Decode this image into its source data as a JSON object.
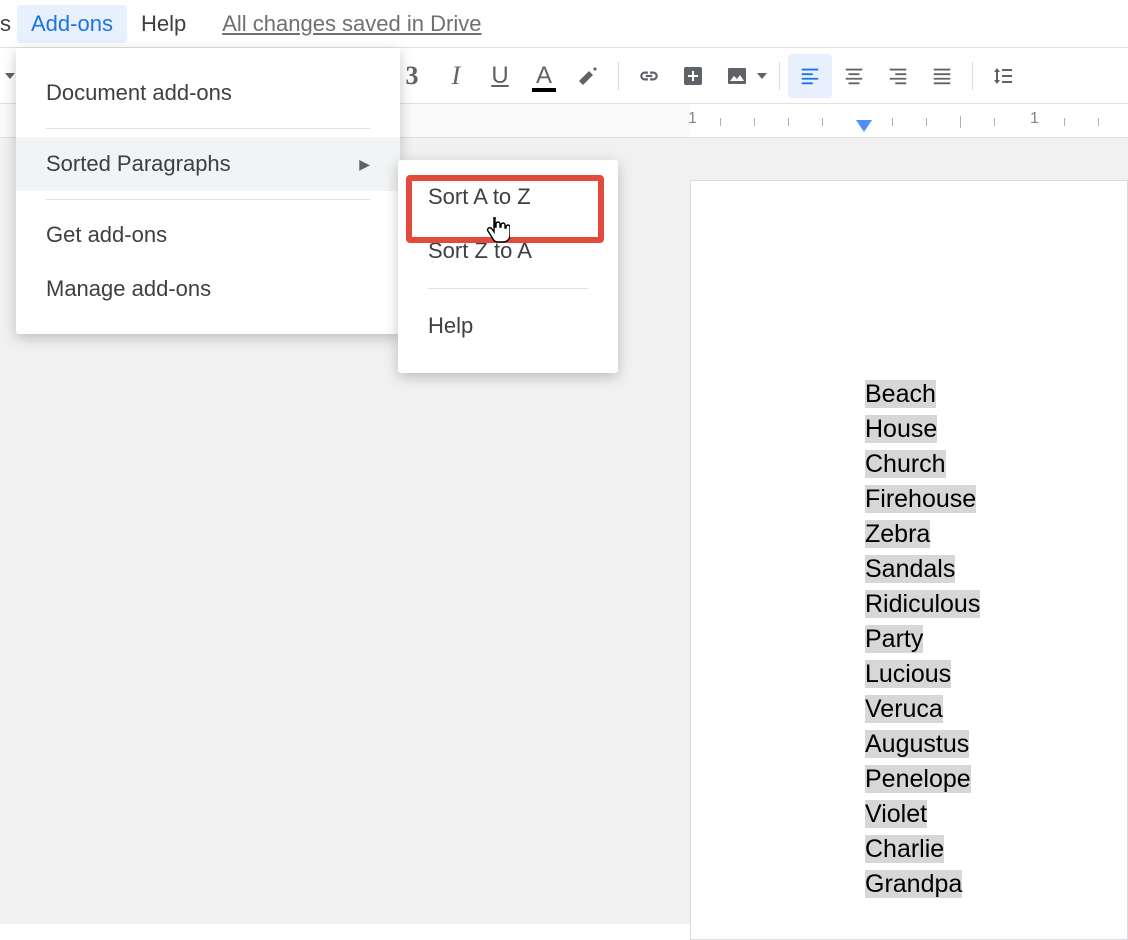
{
  "menubar": {
    "stub": "s",
    "addons": "Add-ons",
    "help": "Help",
    "save_status": "All changes saved in Drive"
  },
  "dropdown": {
    "document_addons": "Document add-ons",
    "sorted_paragraphs": "Sorted Paragraphs",
    "get_addons": "Get add-ons",
    "manage_addons": "Manage add-ons"
  },
  "submenu": {
    "sort_az": "Sort A to Z",
    "sort_za": "Sort Z to A",
    "help": "Help"
  },
  "ruler": {
    "num_left": "1",
    "num_right": "1"
  },
  "document": {
    "lines": [
      "Beach",
      "House",
      "Church",
      "Firehouse",
      "Zebra",
      "Sandals",
      "Ridiculous",
      "Party",
      "Lucious",
      "Veruca",
      "Augustus",
      "Penelope",
      "Violet",
      "Charlie",
      "Grandpa"
    ]
  },
  "toolbar": {
    "bold_partial": "3"
  }
}
